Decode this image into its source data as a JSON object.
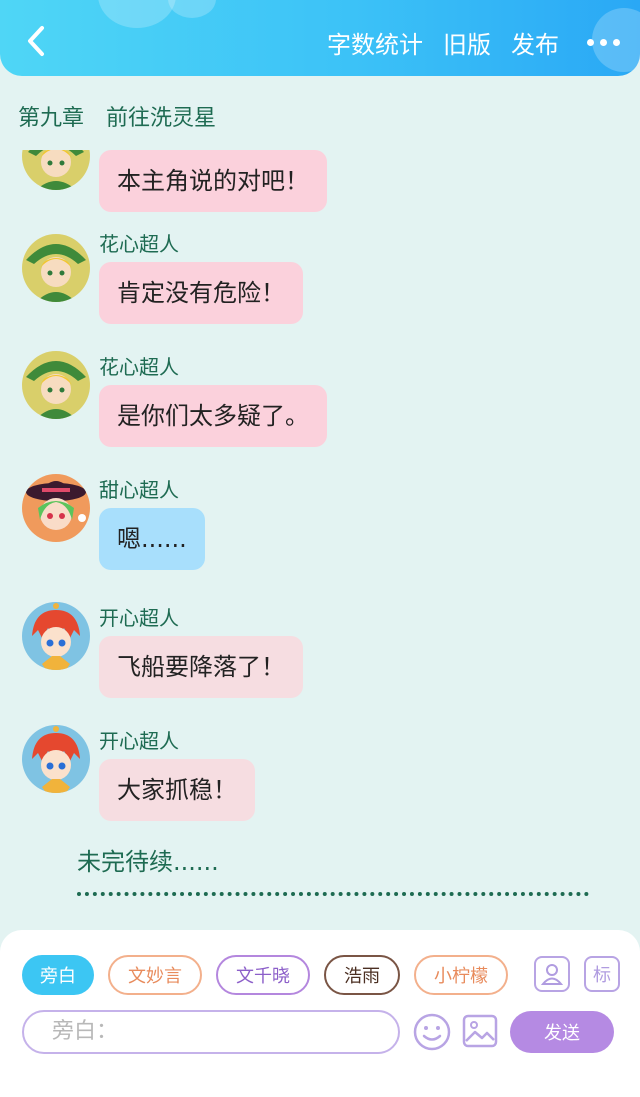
{
  "header": {
    "back_icon": "chevron-left-icon",
    "actions": [
      "字数统计",
      "旧版",
      "发布"
    ],
    "more_icon": "more-dots-icon"
  },
  "chapter": {
    "number": "第九章",
    "title": "前往洗灵星"
  },
  "messages": [
    {
      "sender": "",
      "text": "本主角说的对吧！",
      "bubble": "pink",
      "avatar": "green-hat-boy-avatar"
    },
    {
      "sender": "花心超人",
      "text": "肯定没有危险！",
      "bubble": "pink",
      "avatar": "green-hat-boy-avatar"
    },
    {
      "sender": "花心超人",
      "text": "是你们太多疑了。",
      "bubble": "pink",
      "avatar": "green-hat-boy-avatar"
    },
    {
      "sender": "甜心超人",
      "text": "嗯......",
      "bubble": "blue",
      "avatar": "witch-hat-girl-avatar"
    },
    {
      "sender": "开心超人",
      "text": "飞船要降落了！",
      "bubble": "rose",
      "avatar": "red-hair-boy-avatar"
    },
    {
      "sender": "开心超人",
      "text": "大家抓稳！",
      "bubble": "rose",
      "avatar": "red-hair-boy-avatar"
    }
  ],
  "narration": "未完待续......",
  "composer": {
    "roles": [
      "旁白",
      "文妙言",
      "文千晓",
      "浩雨",
      "小柠檬"
    ],
    "active_role": "旁白",
    "tools": {
      "character_icon": "person-card-icon",
      "mark_label": "标"
    },
    "input_placeholder": "旁白：",
    "emoji_icon": "smiley-icon",
    "image_icon": "image-icon",
    "send_label": "发送"
  },
  "colors": {
    "header_gradient_start": "#4fd6f6",
    "header_gradient_end": "#2aa8f5",
    "page_background": "#e3f3f2",
    "text_green": "#1e6b52",
    "bubble_pink": "#fbd1dc",
    "bubble_blue": "#a8dffc",
    "bubble_rose": "#f6dde1",
    "send_button": "#b58ae3"
  }
}
